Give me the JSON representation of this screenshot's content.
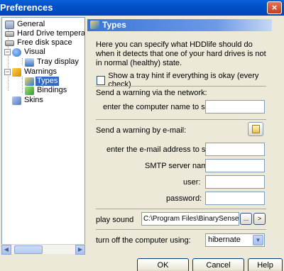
{
  "window": {
    "title": "Preferences",
    "close_glyph": "×"
  },
  "tree": {
    "items": [
      {
        "label": "General",
        "icon": "settings-icon"
      },
      {
        "label": "Hard Drive temperat",
        "icon": "hard-drive-icon"
      },
      {
        "label": "Free disk space",
        "icon": "disk-icon"
      },
      {
        "label": "Visual",
        "icon": "visual-icon",
        "expander": "−"
      },
      {
        "label": "Tray display",
        "icon": "tray-icon"
      },
      {
        "label": "Warnings",
        "icon": "warnings-icon",
        "expander": "−"
      },
      {
        "label": "Types",
        "icon": "types-icon",
        "selected": true
      },
      {
        "label": "Bindings",
        "icon": "bindings-icon"
      },
      {
        "label": "Skins",
        "icon": "skins-icon"
      }
    ]
  },
  "header": {
    "title": "Types",
    "icon": "types-icon"
  },
  "panel": {
    "description": "Here you can specify what HDDlife should do when it detects that one of your hard drives is not in normal (healthy) state.",
    "tray_hint_label": "Show a tray hint if everything is okay (every check)",
    "network": {
      "section_label": "Send a warning via the network:",
      "computer_name_label": "enter the computer name to send",
      "computer_name_value": ""
    },
    "email": {
      "section_label": "Send a warning by e-mail:",
      "address_label": "enter the e-mail address to send",
      "address_value": "",
      "smtp_label": "SMTP server name:",
      "smtp_value": "",
      "user_label": "user:",
      "user_value": "",
      "password_label": "password:",
      "password_value": ""
    },
    "sound": {
      "label": "play sound",
      "path": "C:\\Program Files\\BinarySense\\HD",
      "browse_label": "...",
      "play_label": ">"
    },
    "shutdown": {
      "label": "turn off the computer using:",
      "selected": "hibernate"
    }
  },
  "buttons": {
    "ok": "OK",
    "cancel": "Cancel",
    "help": "Help"
  }
}
